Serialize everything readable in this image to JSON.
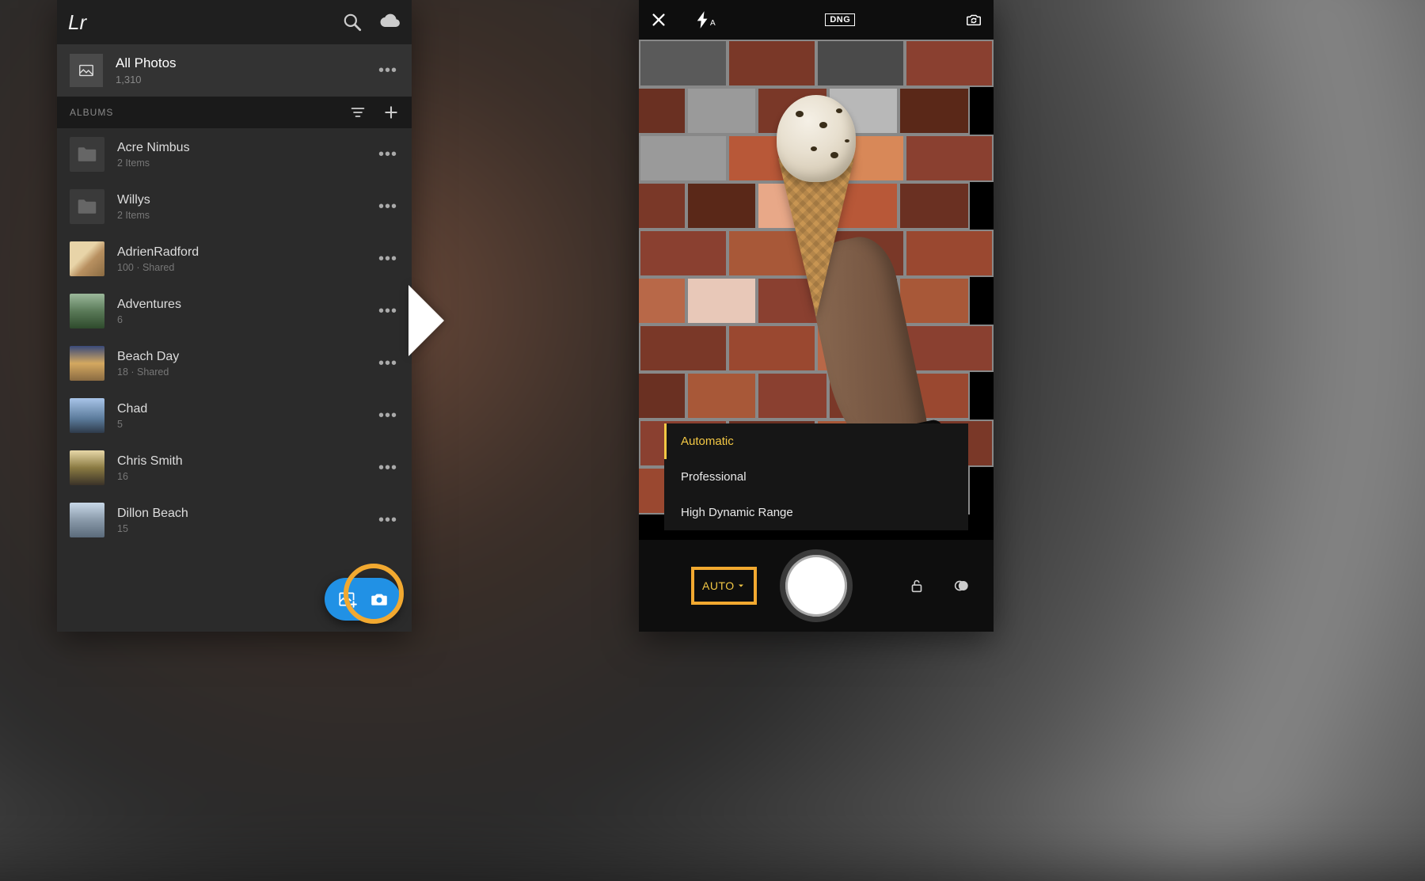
{
  "left": {
    "logo": "Lr",
    "all_photos": {
      "title": "All Photos",
      "count": "1,310"
    },
    "albums_label": "ALBUMS",
    "albums": [
      {
        "name": "Acre Nimbus",
        "meta": "2 Items",
        "type": "folder"
      },
      {
        "name": "Willys",
        "meta": "2 Items",
        "type": "folder"
      },
      {
        "name": "AdrienRadford",
        "meta": "100 · Shared",
        "type": "t1"
      },
      {
        "name": "Adventures",
        "meta": "6",
        "type": "t2"
      },
      {
        "name": "Beach Day",
        "meta": "18 · Shared",
        "type": "t3"
      },
      {
        "name": "Chad",
        "meta": "5",
        "type": "t4"
      },
      {
        "name": "Chris Smith",
        "meta": "16",
        "type": "t5"
      },
      {
        "name": "Dillon Beach",
        "meta": "15",
        "type": "t6"
      }
    ]
  },
  "right": {
    "flash_mode": "A",
    "format_badge": "DNG",
    "modes": [
      {
        "label": "Automatic",
        "active": true
      },
      {
        "label": "Professional",
        "active": false
      },
      {
        "label": "High Dynamic Range",
        "active": false
      }
    ],
    "auto_button": "AUTO"
  }
}
